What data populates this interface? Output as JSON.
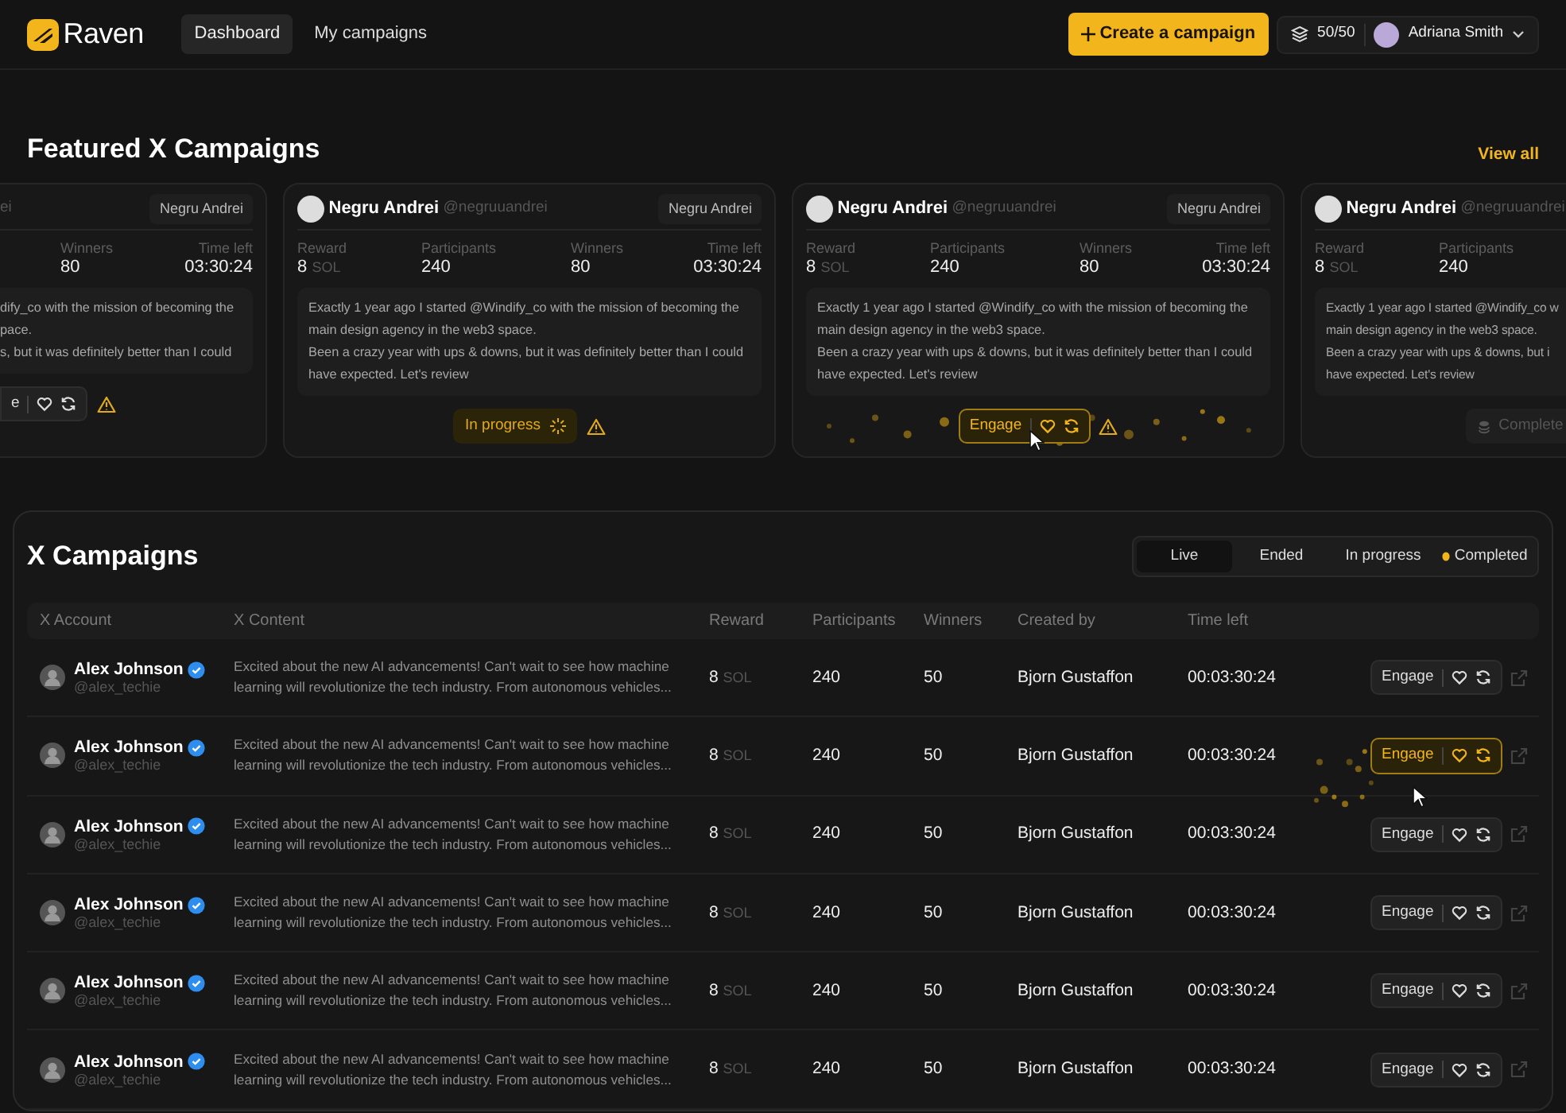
{
  "navbar": {
    "brand": "Raven",
    "links": [
      {
        "label": "Dashboard",
        "selected": true
      },
      {
        "label": "My campaigns",
        "selected": false
      }
    ],
    "create_button": "Create a campaign",
    "credits": "50/50",
    "user": "Adriana Smith"
  },
  "featured": {
    "title": "Featured X Campaigns",
    "view_all": "View all",
    "cards": [
      {
        "kind": "partial_left",
        "handle": "ei",
        "badge": "Negru Andrei",
        "stats": [
          {
            "label": "Winners",
            "value": "80"
          },
          {
            "label": "Time left",
            "value": "03:30:24"
          }
        ],
        "content": [
          "dify_co with the mission of becoming the",
          "pace.",
          "s, but it was definitely better than I could"
        ],
        "action": {
          "kind": "engage",
          "label": "e",
          "active": false
        },
        "warning": true
      },
      {
        "kind": "full",
        "name": "Negru Andrei",
        "handle": "@negruuandrei",
        "badge": "Negru Andrei",
        "stats": [
          {
            "label": "Reward",
            "value": "8",
            "unit": "SOL"
          },
          {
            "label": "Participants",
            "value": "240"
          },
          {
            "label": "Winners",
            "value": "80"
          },
          {
            "label": "Time left",
            "value": "03:30:24"
          }
        ],
        "content": [
          "Exactly 1 year ago I started @Windify_co with the mission of becoming the",
          "main design agency in the web3 space.",
          "Been a crazy year with ups & downs, but it was definitely better than I could",
          "have expected. Let's review"
        ],
        "action": {
          "kind": "in_progress",
          "label": "In progress",
          "active": false
        },
        "warning": true
      },
      {
        "kind": "full",
        "name": "Negru Andrei",
        "handle": "@negruuandrei",
        "badge": "Negru Andrei",
        "stats": [
          {
            "label": "Reward",
            "value": "8",
            "unit": "SOL"
          },
          {
            "label": "Participants",
            "value": "240"
          },
          {
            "label": "Winners",
            "value": "80"
          },
          {
            "label": "Time left",
            "value": "03:30:24"
          }
        ],
        "content": [
          "Exactly 1 year ago I started @Windify_co with the mission of becoming the",
          "main design agency in the web3 space.",
          "Been a crazy year with ups & downs, but it was definitely better than I could",
          "have expected. Let's review"
        ],
        "action": {
          "kind": "engage",
          "label": "Engage",
          "active": true
        },
        "warning": true
      },
      {
        "kind": "partial_right",
        "name": "Negru Andrei",
        "handle": "@negruuandrei",
        "stats": [
          {
            "label": "Reward",
            "value": "8",
            "unit": "SOL"
          },
          {
            "label": "Participants",
            "value": "240"
          }
        ],
        "content": [
          "Exactly 1 year ago I started @Windify_co w",
          "main design agency in the web3 space.",
          "Been a crazy year with ups & downs, but i",
          "have expected. Let's review"
        ],
        "action": {
          "kind": "completed",
          "label": "Complete",
          "active": false
        },
        "warning": false
      }
    ]
  },
  "campaigns": {
    "title": "X Campaigns",
    "tabs": [
      {
        "label": "Live",
        "selected": true,
        "dot": false
      },
      {
        "label": "Ended",
        "selected": false,
        "dot": false
      },
      {
        "label": "In progress",
        "selected": false,
        "dot": false
      },
      {
        "label": "Completed",
        "selected": false,
        "dot": true
      }
    ],
    "columns": [
      "X Account",
      "X Content",
      "Reward",
      "Participants",
      "Winners",
      "Created by",
      "Time left"
    ],
    "rows": [
      {
        "name": "Alex Johnson",
        "handle": "@alex_techie",
        "verified": true,
        "content": "Excited about the new AI advancements! Can't wait to see how machine learning will revolutionize the tech industry. From autonomous vehicles...",
        "reward": "8",
        "unit": "SOL",
        "participants": "240",
        "winners": "50",
        "created_by": "Bjorn Gustaffon",
        "time_left": "00:03:30:24",
        "action": "Engage",
        "active": false
      },
      {
        "name": "Alex Johnson",
        "handle": "@alex_techie",
        "verified": true,
        "content": "Excited about the new AI advancements! Can't wait to see how machine learning will revolutionize the tech industry. From autonomous vehicles...",
        "reward": "8",
        "unit": "SOL",
        "participants": "240",
        "winners": "50",
        "created_by": "Bjorn Gustaffon",
        "time_left": "00:03:30:24",
        "action": "Engage",
        "active": true
      },
      {
        "name": "Alex Johnson",
        "handle": "@alex_techie",
        "verified": true,
        "content": "Excited about the new AI advancements! Can't wait to see how machine learning will revolutionize the tech industry. From autonomous vehicles...",
        "reward": "8",
        "unit": "SOL",
        "participants": "240",
        "winners": "50",
        "created_by": "Bjorn Gustaffon",
        "time_left": "00:03:30:24",
        "action": "Engage",
        "active": false
      },
      {
        "name": "Alex Johnson",
        "handle": "@alex_techie",
        "verified": true,
        "content": "Excited about the new AI advancements! Can't wait to see how machine learning will revolutionize the tech industry. From autonomous vehicles...",
        "reward": "8",
        "unit": "SOL",
        "participants": "240",
        "winners": "50",
        "created_by": "Bjorn Gustaffon",
        "time_left": "00:03:30:24",
        "action": "Engage",
        "active": false
      },
      {
        "name": "Alex Johnson",
        "handle": "@alex_techie",
        "verified": true,
        "content": "Excited about the new AI advancements! Can't wait to see how machine learning will revolutionize the tech industry. From autonomous vehicles...",
        "reward": "8",
        "unit": "SOL",
        "participants": "240",
        "winners": "50",
        "created_by": "Bjorn Gustaffon",
        "time_left": "00:03:30:24",
        "action": "Engage",
        "active": false
      },
      {
        "name": "Alex Johnson",
        "handle": "@alex_techie",
        "verified": true,
        "content": "Excited about the new AI advancements! Can't wait to see how machine learning will revolutionize the tech industry. From autonomous vehicles...",
        "reward": "8",
        "unit": "SOL",
        "participants": "240",
        "winners": "50",
        "created_by": "Bjorn Gustaffon",
        "time_left": "00:03:30:24",
        "action": "Engage",
        "active": false
      }
    ]
  }
}
